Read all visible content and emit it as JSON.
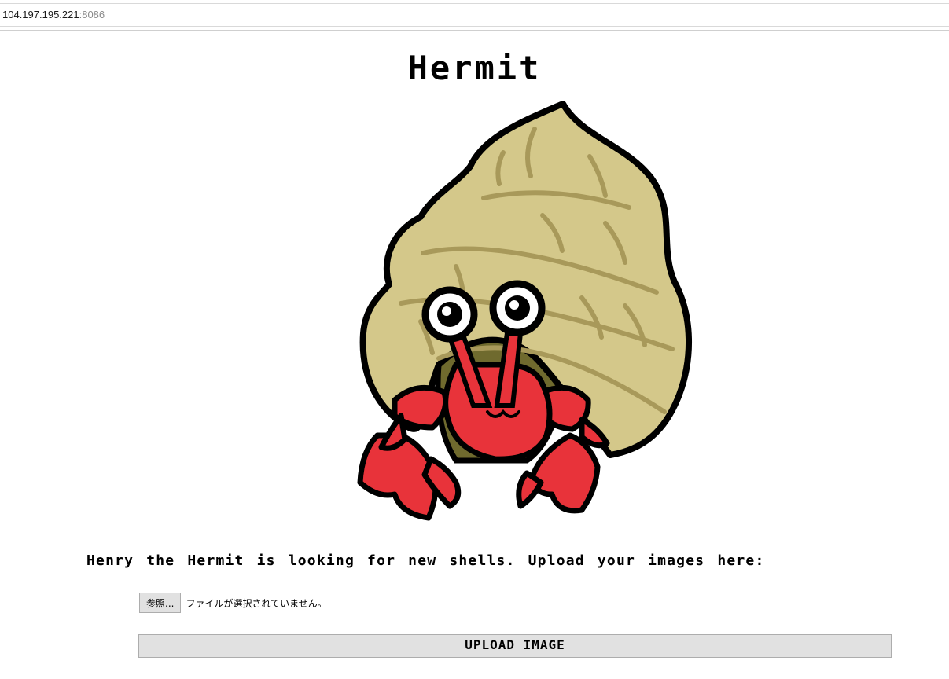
{
  "browser": {
    "url_host": "104.197.195.221",
    "url_port": ":8086"
  },
  "page": {
    "title": "Hermit",
    "tagline": "Henry the Hermit is looking for new shells. Upload your images here:"
  },
  "upload_form": {
    "browse_label": "参照...",
    "file_status": "ファイルが選択されていません。",
    "submit_label": "UPLOAD IMAGE"
  },
  "illustration": {
    "icon": "hermit-crab-illustration",
    "colors": {
      "shell": "#d4c88a",
      "shell_stripes": "#a8995a",
      "crab": "#e8333a",
      "shell_interior": "#6f6a2e",
      "outline": "#000000"
    }
  }
}
